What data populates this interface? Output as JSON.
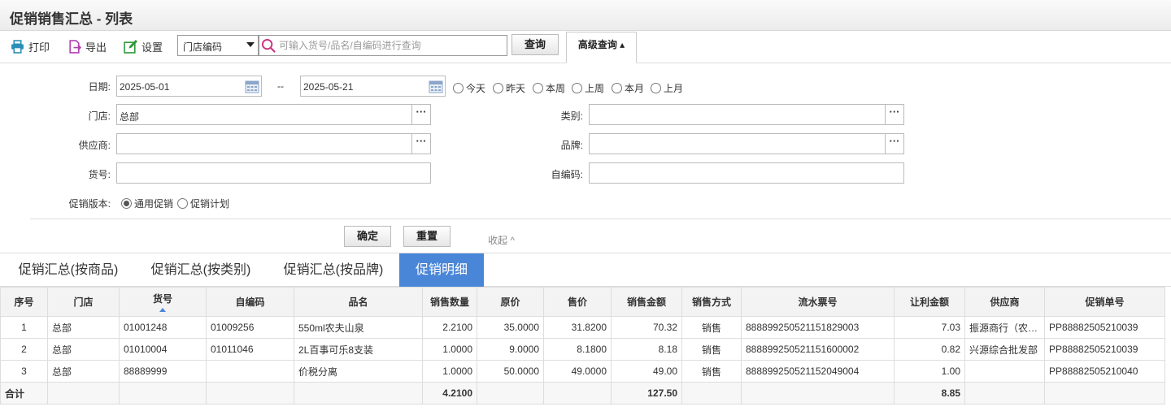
{
  "page": {
    "title": "促销销售汇总 - 列表"
  },
  "toolbar": {
    "print_label": "打印",
    "export_label": "导出",
    "settings_label": "设置",
    "store_select": "门店编码",
    "search_placeholder": "可输入货号/品名/自编码进行查询",
    "query_label": "查询",
    "advanced_label": "高级查询 ▴"
  },
  "filters": {
    "date_label": "日期:",
    "date_from": "2025-05-01",
    "date_sep": "--",
    "date_to": "2025-05-21",
    "quick_ranges": [
      "今天",
      "昨天",
      "本周",
      "上周",
      "本月",
      "上月"
    ],
    "store_label": "门店:",
    "store_value": "总部",
    "category_label": "类别:",
    "category_value": "",
    "supplier_label": "供应商:",
    "supplier_value": "",
    "brand_label": "品牌:",
    "brand_value": "",
    "item_no_label": "货号:",
    "item_no_value": "",
    "self_code_label": "自编码:",
    "self_code_value": "",
    "version_label": "促销版本:",
    "version_options": [
      "通用促销",
      "促销计划"
    ],
    "version_selected": "通用促销",
    "ellipsis": "···",
    "confirm_label": "确定",
    "reset_label": "重置",
    "collapse_label": "收起 ^"
  },
  "tabs": [
    {
      "label": "促销汇总(按商品)",
      "active": false
    },
    {
      "label": "促销汇总(按类别)",
      "active": false
    },
    {
      "label": "促销汇总(按品牌)",
      "active": false
    },
    {
      "label": "促销明细",
      "active": true
    }
  ],
  "table": {
    "headers": [
      "序号",
      "门店",
      "货号",
      "自编码",
      "品名",
      "销售数量",
      "原价",
      "售价",
      "销售金额",
      "销售方式",
      "流水票号",
      "让利金额",
      "供应商",
      "促销单号"
    ],
    "rows": [
      [
        "1",
        "总部",
        "01001248",
        "01009256",
        "550ml农夫山泉",
        "2.2100",
        "35.0000",
        "31.8200",
        "70.32",
        "销售",
        "888899250521151829003",
        "7.03",
        "振源商行（农…",
        "PP88882505210039"
      ],
      [
        "2",
        "总部",
        "01010004",
        "01011046",
        "2L百事可乐8支装",
        "1.0000",
        "9.0000",
        "8.1800",
        "8.18",
        "销售",
        "888899250521151600002",
        "0.82",
        "兴源综合批发部",
        "PP88882505210039"
      ],
      [
        "3",
        "总部",
        "88889999",
        "",
        "价税分离",
        "1.0000",
        "50.0000",
        "49.0000",
        "49.00",
        "销售",
        "888899250521152049004",
        "1.00",
        "",
        "PP88882505210040"
      ]
    ],
    "total": {
      "label": "合计",
      "qty": "4.2100",
      "amount": "127.50",
      "discount": "8.85"
    }
  },
  "colors": {
    "accent": "#4a86d8"
  }
}
